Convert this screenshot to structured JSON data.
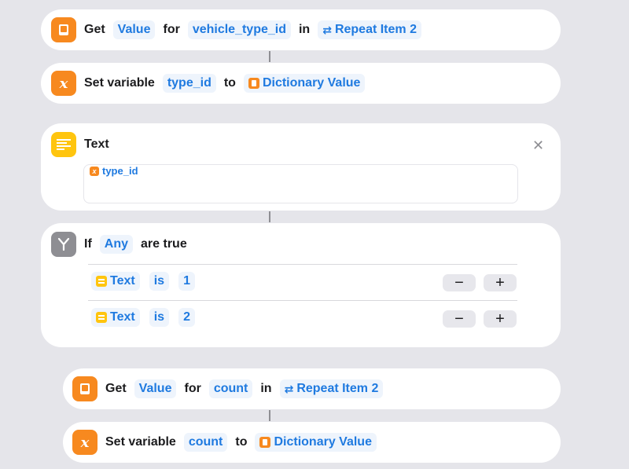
{
  "get_value_1": {
    "get": "Get",
    "key": "Value",
    "for": "for",
    "field": "vehicle_type_id",
    "in": "in",
    "source": "Repeat Item 2",
    "icon": "book-icon",
    "accent": "#f7891f"
  },
  "set_var_1": {
    "label": "Set variable",
    "name": "type_id",
    "to": "to",
    "value": "Dictionary Value",
    "icon": "variable-x-icon"
  },
  "text_action": {
    "title": "Text",
    "token": "type_id",
    "icon": "text-lines-icon",
    "close_icon": "close-icon"
  },
  "if_action": {
    "if": "If",
    "mode": "Any",
    "suffix": "are true",
    "icon": "branch-icon",
    "conditions": [
      {
        "subject": "Text",
        "op": "is",
        "value": "1",
        "minus": "−",
        "plus": "+"
      },
      {
        "subject": "Text",
        "op": "is",
        "value": "2",
        "minus": "−",
        "plus": "+"
      }
    ]
  },
  "get_value_2": {
    "get": "Get",
    "key": "Value",
    "for": "for",
    "field": "count",
    "in": "in",
    "source": "Repeat Item 2"
  },
  "set_var_2": {
    "label": "Set variable",
    "name": "count",
    "to": "to",
    "value": "Dictionary Value"
  },
  "colors": {
    "background": "#e5e5ea",
    "card": "#ffffff",
    "link": "#1f7ae0",
    "orange": "#f7891f",
    "yellow": "#ffc50f"
  }
}
